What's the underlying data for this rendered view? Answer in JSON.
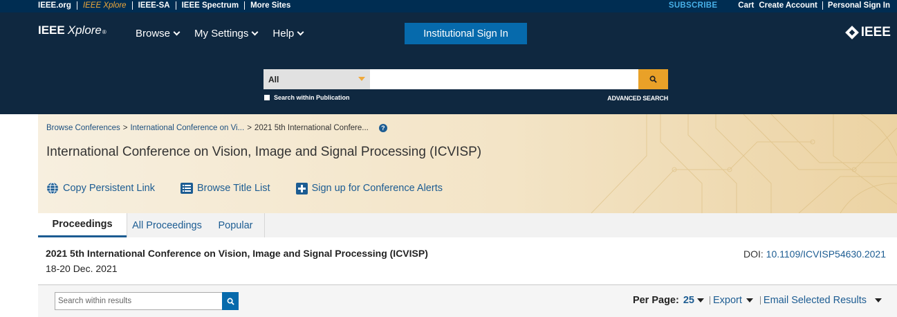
{
  "topbar": {
    "links": [
      "IEEE.org",
      "IEEE Xplore",
      "IEEE-SA",
      "IEEE Spectrum",
      "More Sites"
    ],
    "subscribe": "SUBSCRIBE",
    "right_links": [
      "Cart",
      "Create Account",
      "Personal Sign In"
    ]
  },
  "header": {
    "logo_bold": "IEEE",
    "logo_italic": "Xplore",
    "logo_reg": "®",
    "nav": [
      "Browse",
      "My Settings",
      "Help"
    ],
    "signin_label": "Institutional Sign In",
    "brand": "IEEE"
  },
  "search": {
    "scope": "All",
    "query": "",
    "within_publication_label": "Search within Publication",
    "advanced_label": "ADVANCED SEARCH"
  },
  "banner": {
    "breadcrumbs": [
      "Browse Conferences",
      "International Conference on Vi...",
      "2021 5th International Confere..."
    ],
    "conference_title": "International Conference on Vision, Image and Signal Processing (ICVISP)",
    "actions": [
      "Copy Persistent Link",
      "Browse Title List",
      "Sign up for Conference Alerts"
    ]
  },
  "tabs": [
    "Proceedings",
    "All Proceedings",
    "Popular"
  ],
  "proceeding": {
    "title": "2021 5th International Conference on Vision, Image and Signal Processing (ICVISP)",
    "dates": "18-20 Dec. 2021",
    "doi_label": "DOI:",
    "doi": "10.1109/ICVISP54630.2021"
  },
  "results": {
    "search_placeholder": "Search within results",
    "per_page_label": "Per Page:",
    "per_page_value": "25",
    "export_label": "Export",
    "email_label": "Email Selected Results"
  },
  "colors": {
    "header_bg": "#0f2840",
    "topbar_bg": "#002d52",
    "accent_orange": "#e9a128",
    "link_blue": "#1c5c92",
    "button_blue": "#066aac"
  }
}
